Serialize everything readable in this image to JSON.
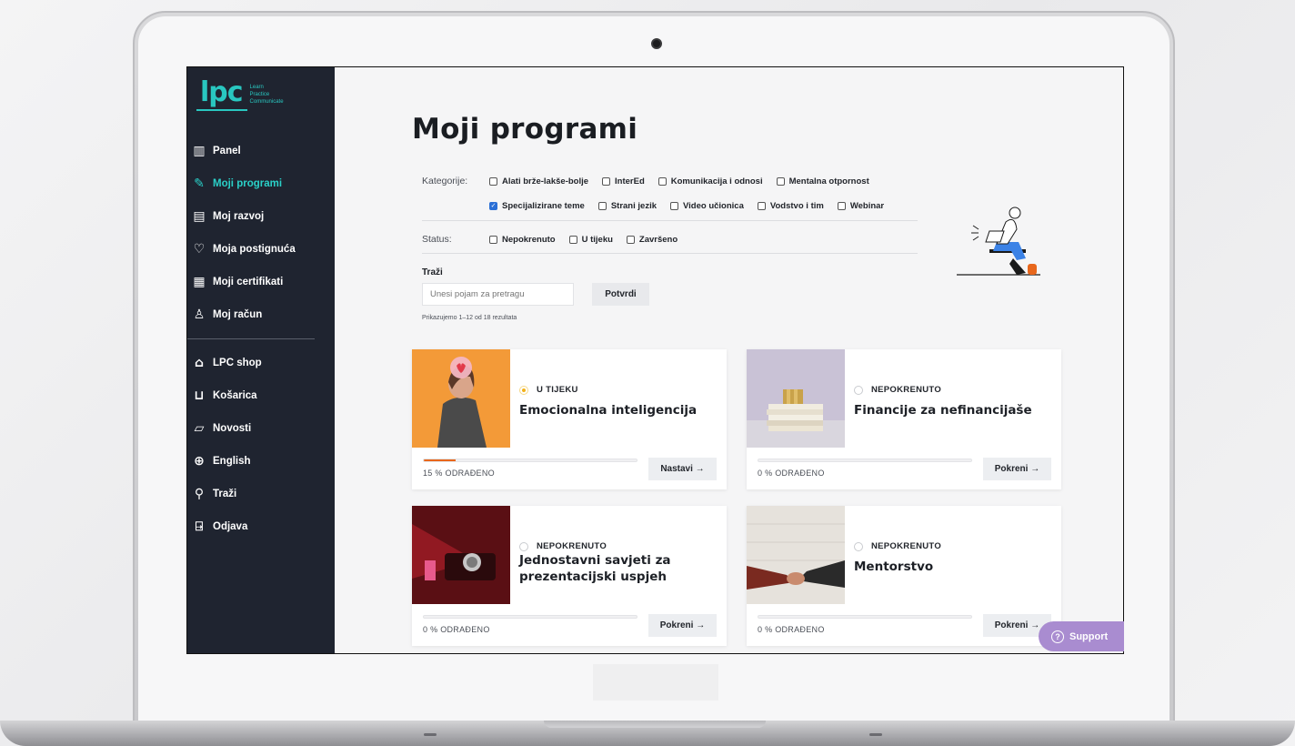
{
  "brand": {
    "logo_text": "lpc",
    "tagline_1": "Learn",
    "tagline_2": "Practice",
    "tagline_3": "Communicate"
  },
  "sidebar": {
    "items": [
      {
        "label": "Panel",
        "icon": "panel-icon"
      },
      {
        "label": "Moji programi",
        "icon": "programs-icon",
        "active": true
      },
      {
        "label": "Moj razvoj",
        "icon": "development-icon"
      },
      {
        "label": "Moja postignuća",
        "icon": "achievements-icon"
      },
      {
        "label": "Moji certifikati",
        "icon": "certificate-icon"
      },
      {
        "label": "Moj račun",
        "icon": "user-icon"
      }
    ],
    "items2": [
      {
        "label": "LPC shop",
        "icon": "shop-icon"
      },
      {
        "label": "Košarica",
        "icon": "cart-icon"
      },
      {
        "label": "Novosti",
        "icon": "news-icon"
      },
      {
        "label": "English",
        "icon": "globe-icon"
      },
      {
        "label": "Traži",
        "icon": "search-icon"
      },
      {
        "label": "Odjava",
        "icon": "logout-icon"
      }
    ]
  },
  "main": {
    "title": "Moji programi",
    "filters": {
      "categories_label": "Kategorije:",
      "categories": [
        {
          "label": "Alati brže-lakše-bolje",
          "checked": false
        },
        {
          "label": "InterEd",
          "checked": false
        },
        {
          "label": "Komunikacija i odnosi",
          "checked": false
        },
        {
          "label": "Mentalna otpornost",
          "checked": false
        },
        {
          "label": "Specijalizirane teme",
          "checked": true
        },
        {
          "label": "Strani jezik",
          "checked": false
        },
        {
          "label": "Video učionica",
          "checked": false
        },
        {
          "label": "Vodstvo i tim",
          "checked": false
        },
        {
          "label": "Webinar",
          "checked": false
        }
      ],
      "status_label": "Status:",
      "statuses": [
        {
          "label": "Nepokrenuto",
          "checked": false
        },
        {
          "label": "U tijeku",
          "checked": false
        },
        {
          "label": "Završeno",
          "checked": false
        }
      ]
    },
    "search": {
      "label": "Traži",
      "placeholder": "Unesi pojam za pretragu",
      "button": "Potvrdi"
    },
    "results_text": "Prikazujemo 1–12 od 18 rezultata",
    "courses": [
      {
        "status": "U TIJEKU",
        "title": "Emocionalna inteligencija",
        "progress": 15,
        "progress_text": "15 % ODRAĐENO",
        "action": "Nastavi →",
        "in_progress": true
      },
      {
        "status": "NEPOKRENUTO",
        "title": "Financije za nefinancijaše",
        "progress": 0,
        "progress_text": "0 % ODRAĐENO",
        "action": "Pokreni →",
        "in_progress": false
      },
      {
        "status": "NEPOKRENUTO",
        "title": "Jednostavni savjeti za prezentacijski uspjeh",
        "progress": 0,
        "progress_text": "0 % ODRAĐENO",
        "action": "Pokreni →",
        "in_progress": false
      },
      {
        "status": "NEPOKRENUTO",
        "title": "Mentorstvo",
        "progress": 0,
        "progress_text": "0 % ODRAĐENO",
        "action": "Pokreni →",
        "in_progress": false
      }
    ]
  },
  "support": {
    "label": "Support"
  },
  "colors": {
    "sidebar_bg": "#1f2430",
    "accent_teal": "#2ad0c8",
    "progress_orange": "#e8671c",
    "support_purple": "#a98cd0",
    "checkbox_blue": "#2b6fd6"
  }
}
